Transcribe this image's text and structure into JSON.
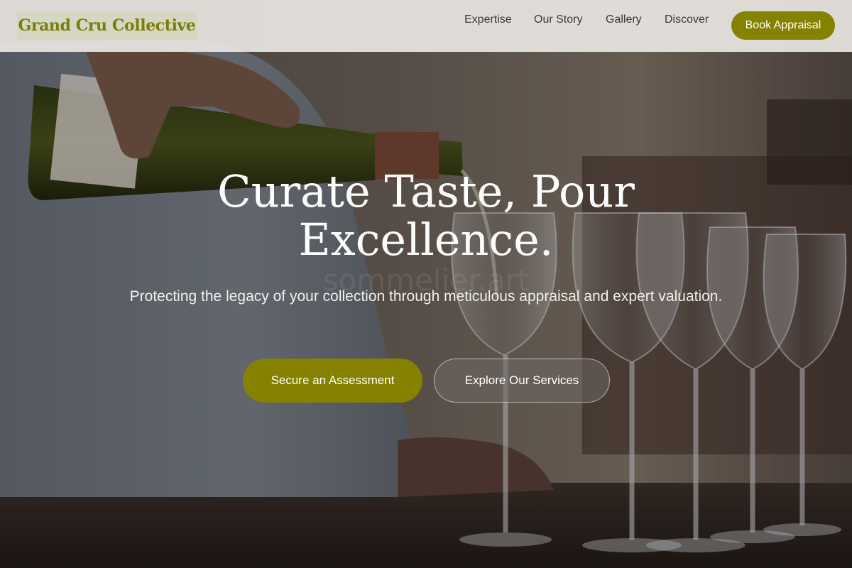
{
  "brand": {
    "name": "Grand Cru Collective",
    "accent": "#858200"
  },
  "nav": {
    "links": [
      "Expertise",
      "Our Story",
      "Gallery",
      "Discover"
    ],
    "cta": "Book Appraisal"
  },
  "hero": {
    "headline_line1": "Curate Taste, Pour",
    "headline_line2": "Excellence.",
    "watermark": "sommelier.art",
    "subtitle": "Protecting the legacy of your collection through meticulous appraisal and expert valuation.",
    "primary_cta": "Secure an Assessment",
    "secondary_cta": "Explore Our Services"
  }
}
